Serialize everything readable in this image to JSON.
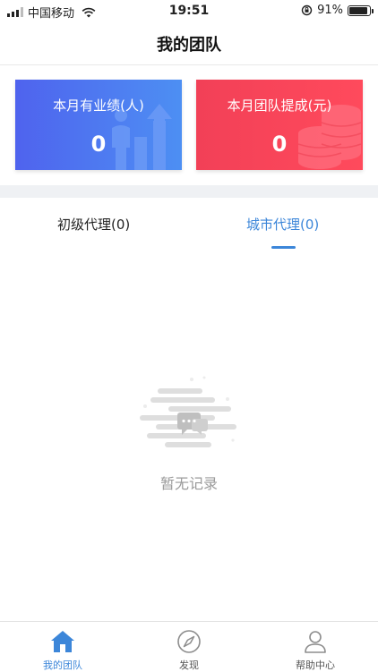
{
  "status_bar": {
    "carrier": "中国移动",
    "time": "19:51",
    "battery": "91%",
    "battery_level": 0.91
  },
  "header": {
    "title": "我的团队"
  },
  "stats": {
    "performance": {
      "label": "本月有业绩(人)",
      "value": "0",
      "color": "#4f7cf0"
    },
    "commission": {
      "label": "本月团队提成(元)",
      "value": "0",
      "color": "#f5425a"
    }
  },
  "tabs": [
    {
      "label": "初级代理(0)",
      "active": false
    },
    {
      "label": "城市代理(0)",
      "active": true
    }
  ],
  "empty_state": {
    "text": "暂无记录"
  },
  "tabbar": {
    "items": [
      {
        "label": "我的团队",
        "icon": "home-icon",
        "active": true
      },
      {
        "label": "发现",
        "icon": "compass-icon",
        "active": false
      },
      {
        "label": "帮助中心",
        "icon": "user-icon",
        "active": false
      }
    ]
  },
  "colors": {
    "accent": "#3c86d9",
    "band": "#eff1f4"
  }
}
